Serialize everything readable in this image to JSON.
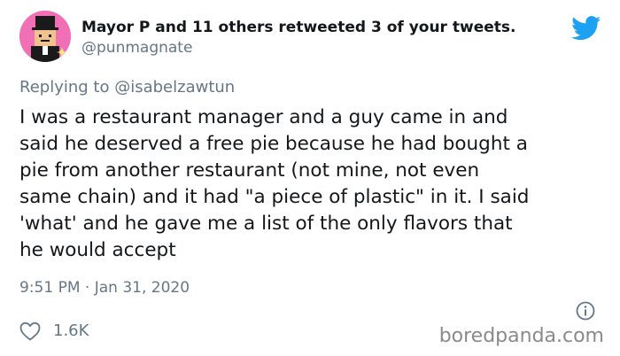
{
  "header": {
    "title": "Mayor P and 11 others retweeted 3 of your tweets.",
    "handle": "@punmagnate",
    "avatar_icon": "avatar-penguin-icon",
    "brand_icon": "twitter-bird-icon",
    "brand_color": "#1da1f2"
  },
  "reply": {
    "prefix": "Replying to",
    "mention": "@isabelzawtun"
  },
  "tweet": {
    "lines": [
      "I was a restaurant manager and a guy came in and",
      "said he deserved a free pie because he had bought a",
      "pie from another restaurant (not mine, not even",
      "same chain) and it had \"a piece of plastic\" in it. I said",
      "'what' and he gave me a list of the only flavors that",
      "he would accept"
    ]
  },
  "meta": {
    "timestamp": "9:51 PM · Jan 31, 2020",
    "info_icon": "info-icon"
  },
  "actions": {
    "like_icon": "heart-icon",
    "like_count": "1.6K"
  },
  "watermark": {
    "text": "boredpanda.com"
  }
}
